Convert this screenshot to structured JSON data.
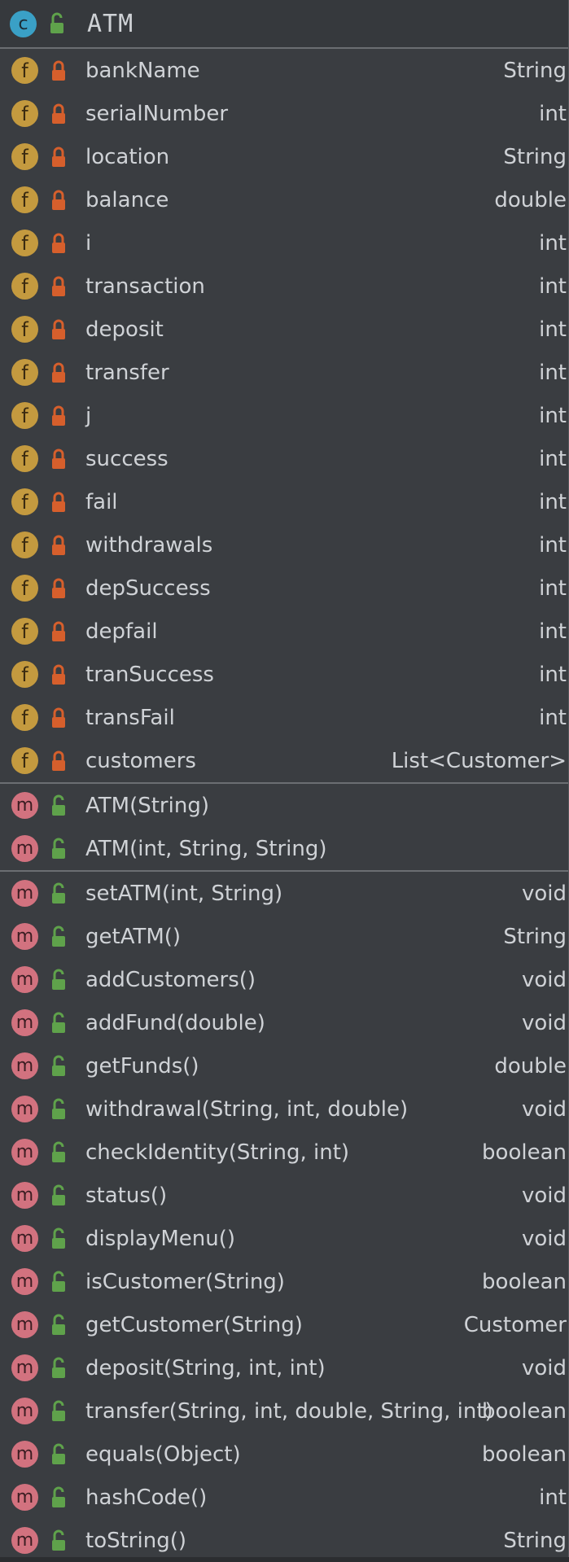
{
  "class_box": {
    "name": "ATM",
    "kind_letter": "c",
    "visibility": "public"
  },
  "colors": {
    "class_badge": "#3aa0c6",
    "field_badge": "#c49a3f",
    "method_badge": "#d2727f",
    "private_lock": "#d65f2c",
    "public_lock": "#5fa24b",
    "text": "#cfd2d6",
    "background": "#3a3d41"
  },
  "fields": [
    {
      "letter": "f",
      "visibility": "private",
      "name": "bankName",
      "type": "String"
    },
    {
      "letter": "f",
      "visibility": "private",
      "name": "serialNumber",
      "type": "int"
    },
    {
      "letter": "f",
      "visibility": "private",
      "name": "location",
      "type": "String"
    },
    {
      "letter": "f",
      "visibility": "private",
      "name": "balance",
      "type": "double"
    },
    {
      "letter": "f",
      "visibility": "private",
      "name": "i",
      "type": "int"
    },
    {
      "letter": "f",
      "visibility": "private",
      "name": "transaction",
      "type": "int"
    },
    {
      "letter": "f",
      "visibility": "private",
      "name": "deposit",
      "type": "int"
    },
    {
      "letter": "f",
      "visibility": "private",
      "name": "transfer",
      "type": "int"
    },
    {
      "letter": "f",
      "visibility": "private",
      "name": "j",
      "type": "int"
    },
    {
      "letter": "f",
      "visibility": "private",
      "name": "success",
      "type": "int"
    },
    {
      "letter": "f",
      "visibility": "private",
      "name": "fail",
      "type": "int"
    },
    {
      "letter": "f",
      "visibility": "private",
      "name": "withdrawals",
      "type": "int"
    },
    {
      "letter": "f",
      "visibility": "private",
      "name": "depSuccess",
      "type": "int"
    },
    {
      "letter": "f",
      "visibility": "private",
      "name": "depfail",
      "type": "int"
    },
    {
      "letter": "f",
      "visibility": "private",
      "name": "tranSuccess",
      "type": "int"
    },
    {
      "letter": "f",
      "visibility": "private",
      "name": "transFail",
      "type": "int"
    },
    {
      "letter": "f",
      "visibility": "private",
      "name": "customers",
      "type": "List<Customer>"
    }
  ],
  "constructors": [
    {
      "letter": "m",
      "visibility": "public",
      "name": "ATM(String)",
      "type": ""
    },
    {
      "letter": "m",
      "visibility": "public",
      "name": "ATM(int, String, String)",
      "type": ""
    }
  ],
  "methods": [
    {
      "letter": "m",
      "visibility": "public",
      "name": "setATM(int, String)",
      "type": "void"
    },
    {
      "letter": "m",
      "visibility": "public",
      "name": "getATM()",
      "type": "String"
    },
    {
      "letter": "m",
      "visibility": "public",
      "name": "addCustomers()",
      "type": "void"
    },
    {
      "letter": "m",
      "visibility": "public",
      "name": "addFund(double)",
      "type": "void"
    },
    {
      "letter": "m",
      "visibility": "public",
      "name": "getFunds()",
      "type": "double"
    },
    {
      "letter": "m",
      "visibility": "public",
      "name": "withdrawal(String, int, double)",
      "type": "void"
    },
    {
      "letter": "m",
      "visibility": "public",
      "name": "checkIdentity(String, int)",
      "type": "boolean"
    },
    {
      "letter": "m",
      "visibility": "public",
      "name": "status()",
      "type": "void"
    },
    {
      "letter": "m",
      "visibility": "public",
      "name": "displayMenu()",
      "type": "void"
    },
    {
      "letter": "m",
      "visibility": "public",
      "name": "isCustomer(String)",
      "type": "boolean"
    },
    {
      "letter": "m",
      "visibility": "public",
      "name": "getCustomer(String)",
      "type": "Customer"
    },
    {
      "letter": "m",
      "visibility": "public",
      "name": "deposit(String, int, int)",
      "type": "void"
    },
    {
      "letter": "m",
      "visibility": "public",
      "name": "transfer(String, int, double, String, int)",
      "type": "boolean"
    },
    {
      "letter": "m",
      "visibility": "public",
      "name": "equals(Object)",
      "type": "boolean"
    },
    {
      "letter": "m",
      "visibility": "public",
      "name": "hashCode()",
      "type": "int"
    },
    {
      "letter": "m",
      "visibility": "public",
      "name": "toString()",
      "type": "String"
    }
  ]
}
